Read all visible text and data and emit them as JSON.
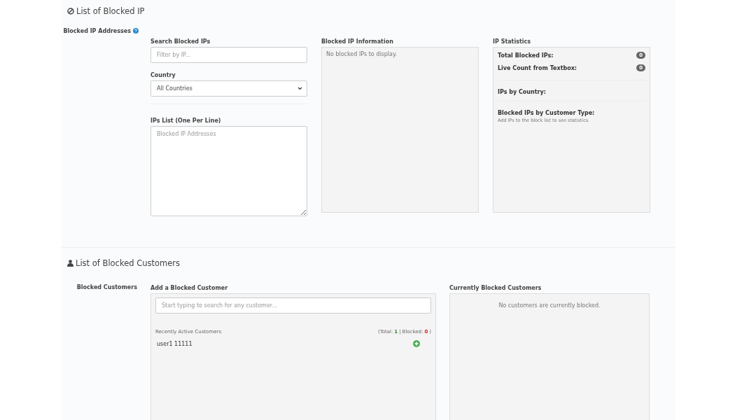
{
  "ip_section": {
    "title": "List of Blocked IP",
    "label": "Blocked IP Addresses",
    "search": {
      "label": "Search Blocked IPs",
      "placeholder": "Filter by IP..."
    },
    "country": {
      "label": "Country",
      "value": "All Countries"
    },
    "ips_list": {
      "label": "IPs List (One Per Line)",
      "placeholder": "Blocked IP Addresses"
    },
    "info": {
      "title": "Blocked IP Information",
      "empty": "No blocked IPs to display."
    },
    "stats": {
      "title": "IP Statistics",
      "counts": [
        {
          "label": "Total Blocked IPs:",
          "value": "0"
        },
        {
          "label": "Live Count from Textbox:",
          "value": "0"
        }
      ],
      "by_country": "IPs by Country:",
      "by_type": "Blocked IPs by Customer Type:",
      "hint": "Add IPs to the block list to see statistics."
    }
  },
  "customer_section": {
    "title": "List of Blocked Customers",
    "label": "Blocked Customers",
    "add": {
      "title": "Add a Blocked Customer",
      "placeholder": "Start typing to search for any customer...",
      "recent_label": "Recently Active Customers",
      "counts": {
        "total_label": "(Total:",
        "total": "1",
        "separator": "|",
        "blocked_label": "Blocked:",
        "blocked": "0",
        "close": ")"
      },
      "customers": [
        {
          "name": "user1 11111"
        }
      ]
    },
    "current": {
      "title": "Currently Blocked Customers",
      "empty": "No customers are currently blocked."
    }
  }
}
